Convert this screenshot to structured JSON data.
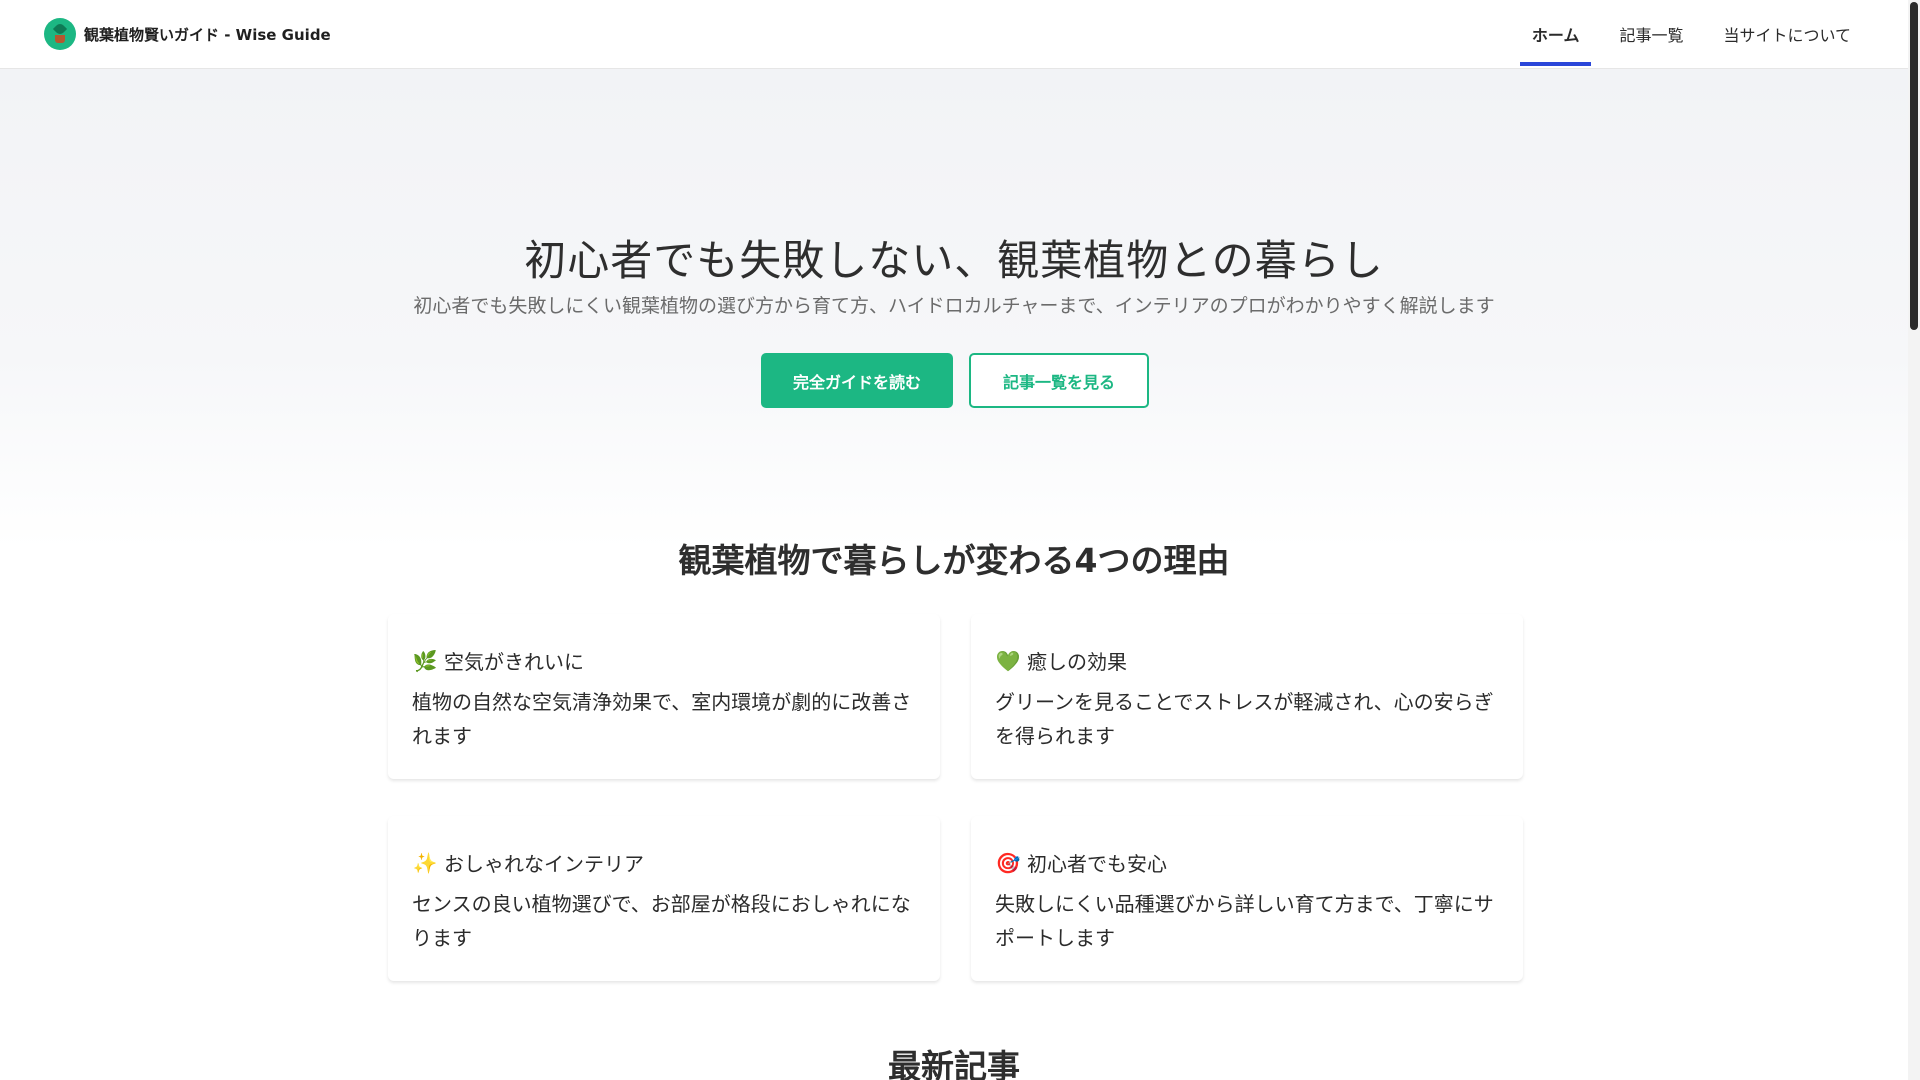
{
  "header": {
    "brand": "観葉植物賢いガイド - Wise Guide",
    "nav": [
      {
        "label": "ホーム",
        "active": true
      },
      {
        "label": "記事一覧",
        "active": false
      },
      {
        "label": "当サイトについて",
        "active": false
      }
    ]
  },
  "hero": {
    "title": "初心者でも失敗しない、観葉植物との暮らし",
    "subtitle": "初心者でも失敗しにくい観葉植物の選び方から育て方、ハイドロカルチャーまで、インテリアのプロがわかりやすく解説します",
    "primary_button": "完全ガイドを読む",
    "secondary_button": "記事一覧を見る"
  },
  "reasons": {
    "title": "観葉植物で暮らしが変わる4つの理由",
    "items": [
      {
        "icon": "herb-icon",
        "emoji": "🌿",
        "title": "空気がきれいに",
        "body": "植物の自然な空気清浄効果で、室内環境が劇的に改善されます"
      },
      {
        "icon": "green-heart-icon",
        "emoji": "💚",
        "title": "癒しの効果",
        "body": "グリーンを見ることでストレスが軽減され、心の安らぎを得られます"
      },
      {
        "icon": "sparkles-icon",
        "emoji": "✨",
        "title": "おしゃれなインテリア",
        "body": "センスの良い植物選びで、お部屋が格段におしゃれになります"
      },
      {
        "icon": "target-icon",
        "emoji": "🎯",
        "title": "初心者でも安心",
        "body": "失敗しにくい品種選びから詳しい育て方まで、丁寧にサポートします"
      }
    ]
  },
  "latest": {
    "title": "最新記事"
  },
  "colors": {
    "accent": "#1cb783",
    "nav_active": "#2a46d9",
    "text": "#2b2b2b",
    "muted": "#6b6b6b"
  }
}
